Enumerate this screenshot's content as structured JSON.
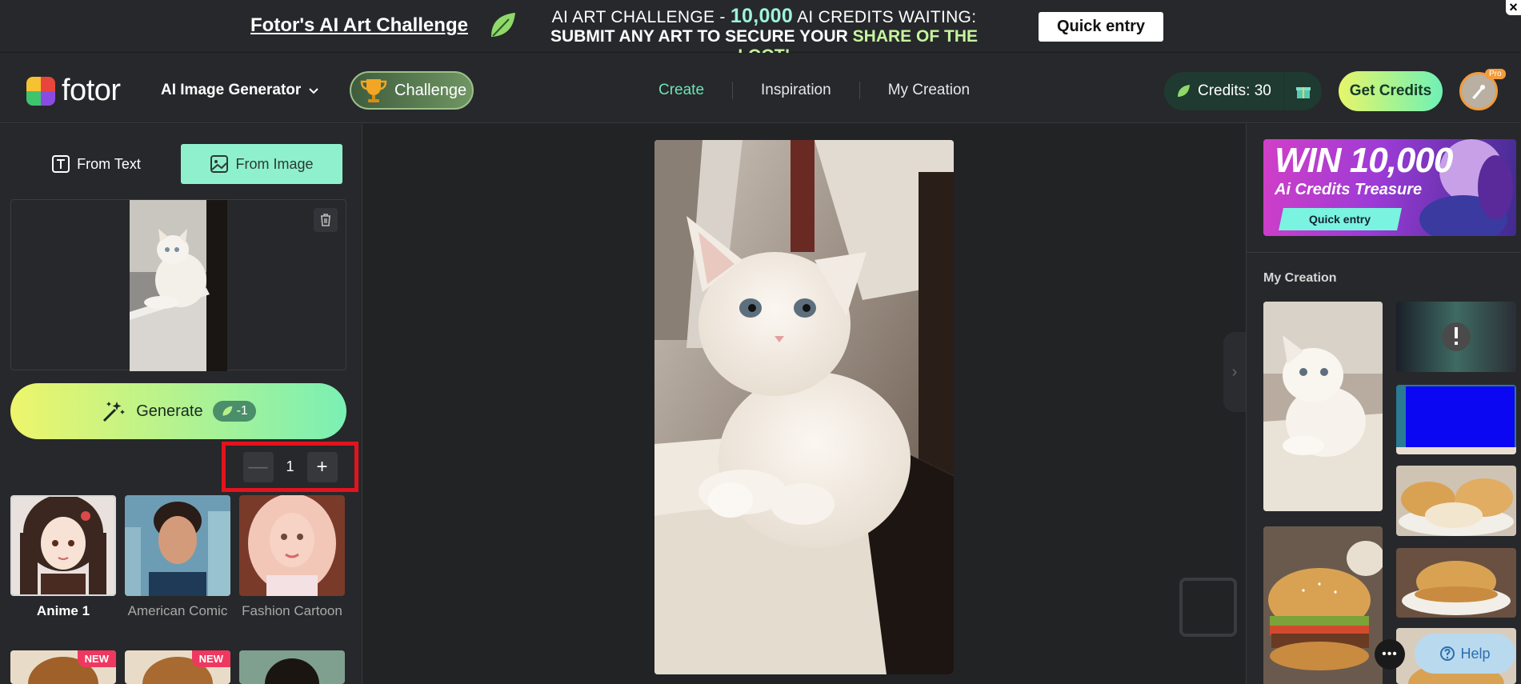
{
  "promo": {
    "title": "Fotor's AI Art Challenge",
    "line1_pre": "AI ART CHALLENGE - ",
    "line1_num": "10,000",
    "line1_post": " AI CREDITS WAITING:",
    "line2_pre": "SUBMIT ANY ART TO SECURE YOUR ",
    "line2_hl": "SHARE OF THE LOOT!",
    "button": "Quick entry",
    "close": "×"
  },
  "header": {
    "logo_text": "fotor",
    "tool_select": "AI Image Generator",
    "challenge": "Challenge",
    "nav": [
      {
        "label": "Create",
        "active": true
      },
      {
        "label": "Inspiration",
        "active": false
      },
      {
        "label": "My Creation",
        "active": false
      }
    ],
    "credits": "Credits: 30",
    "get_credits": "Get Credits",
    "pro_badge": "Pro"
  },
  "left": {
    "tab_text": "From Text",
    "tab_image": "From Image",
    "generate": "Generate",
    "generate_cost": "-1",
    "quantity": "1",
    "styles": [
      {
        "name": "Anime 1",
        "selected": true,
        "new": false
      },
      {
        "name": "American Comic",
        "selected": false,
        "new": false
      },
      {
        "name": "Fashion Cartoon",
        "selected": false,
        "new": false
      },
      {
        "name": "",
        "selected": false,
        "new": true
      },
      {
        "name": "",
        "selected": false,
        "new": true
      },
      {
        "name": "",
        "selected": false,
        "new": false
      }
    ],
    "new_badge": "NEW"
  },
  "right": {
    "ad_title": "WIN 10,000",
    "ad_sub": "Ai Credits Treasure",
    "ad_button": "Quick entry",
    "my_creation": "My Creation",
    "help": "Help"
  },
  "colors": {
    "accent": "#6fe3b5",
    "highlight_box": "#e1141d",
    "tab_active": "#8ff0cd"
  }
}
